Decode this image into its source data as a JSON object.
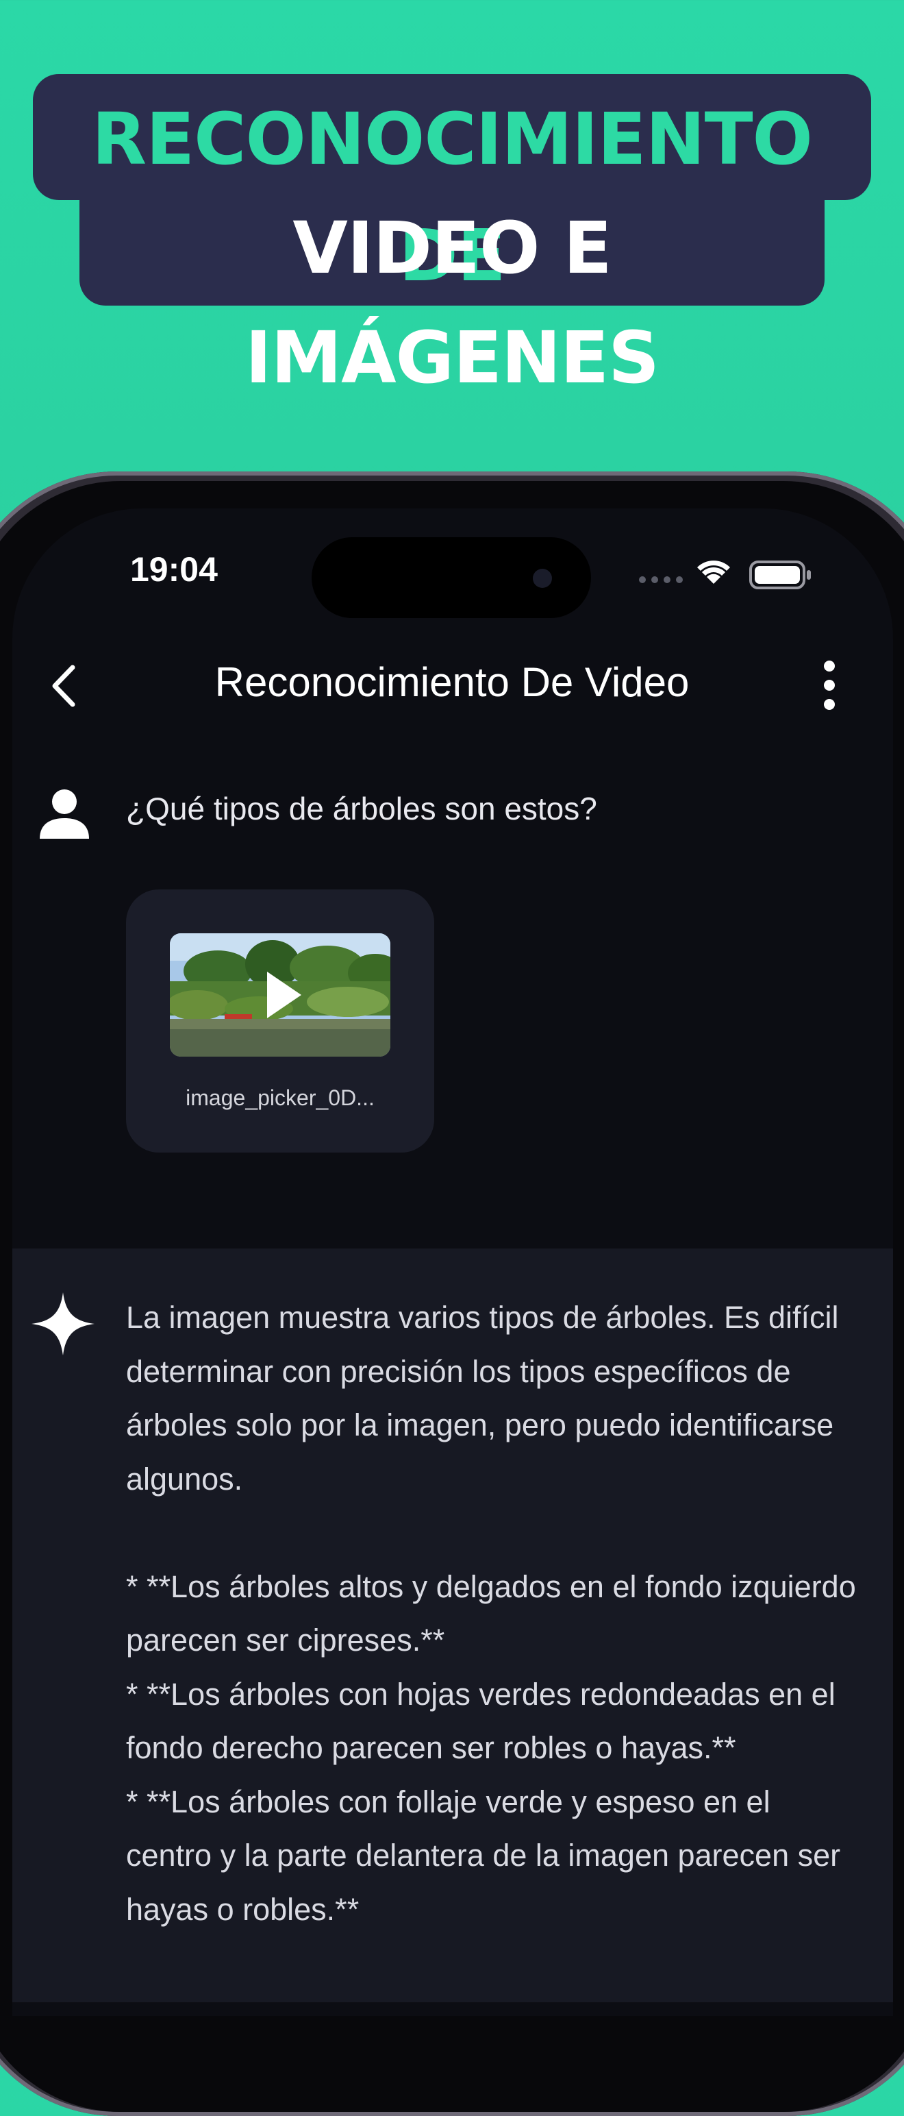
{
  "headline": {
    "line1": "RECONOCIMIENTO DE",
    "line2": "VIDEO E IMÁGENES"
  },
  "status_bar": {
    "time": "19:04",
    "icons": [
      "signal-dots-icon",
      "wifi-icon",
      "battery-icon"
    ]
  },
  "app_bar": {
    "title": "Reconocimiento De Video",
    "back_icon": "chevron-left-icon",
    "menu_icon": "more-vertical-icon"
  },
  "user_message": {
    "text": "¿Qué tipos de árboles son estos?",
    "attachment": {
      "filename": "image_picker_0D...",
      "type": "video"
    }
  },
  "ai_response": {
    "paragraph": "La imagen muestra varios tipos de árboles. Es difícil determinar con precisión los tipos específicos de árboles solo por la imagen, pero puedo identificarse algunos.",
    "bullets": [
      "* **Los árboles altos y delgados en el fondo izquierdo parecen ser cipreses.**",
      "* **Los árboles con hojas verdes redondeadas en el fondo derecho parecen ser robles o hayas.**",
      "* **Los árboles con follaje verde y espeso en el centro y la parte delantera de la imagen parecen ser hayas o robles.**"
    ]
  },
  "colors": {
    "background_top": "#2bd8a7",
    "banner": "#2b2d4d",
    "headline_accent": "#2ddaa4",
    "screen_bg": "#0c0d13",
    "panel_bg": "#171923",
    "card_bg": "#1b1d29"
  }
}
